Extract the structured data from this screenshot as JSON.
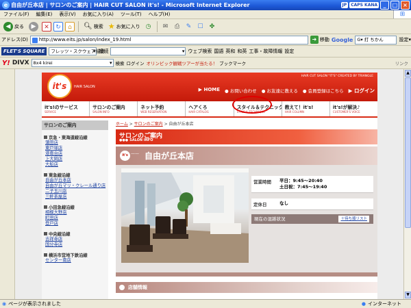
{
  "window": {
    "title": "自由が丘本店 | サロンのご案内 | HAIR CUT SALON it's! - Microsoft Internet Explorer",
    "lang_badge": "JP",
    "tray_label": "CAPS KANA"
  },
  "menu": [
    "ファイル(F)",
    "編集(E)",
    "表示(V)",
    "お気に入り(A)",
    "ツール(T)",
    "ヘルプ(H)"
  ],
  "toolbar": {
    "back": "戻る",
    "search": "検索",
    "favorites": "お気に入り"
  },
  "address": {
    "label": "アドレス(D)",
    "url": "http://www.eits.jp/salon/index_19.html",
    "go": "移動",
    "google_placeholder": "G▾ 打 ちかん"
  },
  "google_toolbar": {
    "settings": "設定▾"
  },
  "toolbar3": {
    "flets": "FLET'S SQUARE",
    "flets_select": "フレッツ・スクウェア接続",
    "exclude": "接続",
    "web_search": "ウェブ検索",
    "links": [
      "国語",
      "英和",
      "和英",
      "工事・故障情報",
      "設定"
    ]
  },
  "toolbar4": {
    "yahoo": "Y!",
    "divx": "DIVX",
    "divx_select": "8x4 kirei",
    "search": "検索",
    "login": "ログイン",
    "promo": "オリンピック観戦ツアーが当たる！",
    "bookmark": "ブックマーク",
    "links_label": "リンク"
  },
  "site": {
    "logo": "it's",
    "logo_sub": "HAIR SALON",
    "tagline": "HAIR CUT SALON \"IT'S\" CREATED BY TRIANGLE",
    "header_links": {
      "home": "HOME",
      "contact": "お問い合わせ",
      "friend": "お友達に教える",
      "register": "会員登録はこちら",
      "login": "ログイン"
    },
    "nav": [
      {
        "jp": "it's!のサービス",
        "en": "SERVICE"
      },
      {
        "jp": "サロンのご案内",
        "en": "SALON INFO"
      },
      {
        "jp": "ネット予約",
        "en": "WEB RESERVATION"
      },
      {
        "jp": "ヘアくろ",
        "en": "HAIR CATALOG"
      },
      {
        "jp": "スタイル＆テクニック",
        "en": "STYLE & TECHNIQUE"
      },
      {
        "jp": "教えて！it's!",
        "en": "HAIR COLUMN"
      },
      {
        "jp": "it's!が解決♪",
        "en": "CUSTOMER'S VOICE"
      }
    ],
    "sidebar": {
      "title": "サロンのご案内",
      "groups": [
        {
          "name": "京急・東海道線沿線",
          "shops": [
            "蒲田店",
            "東戸塚店",
            "港南台店",
            "上大岡店",
            "大船店"
          ]
        },
        {
          "name": "東急線沿線",
          "shops": [
            "自由が丘本店",
            "自由が丘マリ・クレール通り店",
            "二子玉川店",
            "三軒茶屋店"
          ]
        },
        {
          "name": "小田急線沿線",
          "shops": [
            "相模大野店",
            "町田店",
            "登戸店"
          ]
        },
        {
          "name": "中央線沿線",
          "shops": [
            "吉祥寺店",
            "国分寺店"
          ]
        },
        {
          "name": "横浜市営地下鉄沿線",
          "shops": [
            "センター南店"
          ]
        }
      ]
    },
    "breadcrumb": {
      "home": "ホーム",
      "sep": " > ",
      "salon": "サロンのご案内",
      "current": " > 自由が丘本店"
    },
    "section": {
      "title": "サロンのご案内",
      "en": "SALON INFO",
      "dots": "●●●"
    },
    "salon": {
      "name": "自由が丘本店",
      "hours_label": "営業時間",
      "hours_weekday": "平日：9:45〜20:40",
      "hours_weekend": "土日祝：7:45〜19:40",
      "holiday_label": "定休日",
      "holiday_value": "なし",
      "status_label": "現在の混雑状況",
      "status_button": "＋待ち順リスト"
    },
    "store_info": "店舗情報"
  },
  "statusbar": {
    "text": "ページが表示されました",
    "zone": "インターネット"
  }
}
